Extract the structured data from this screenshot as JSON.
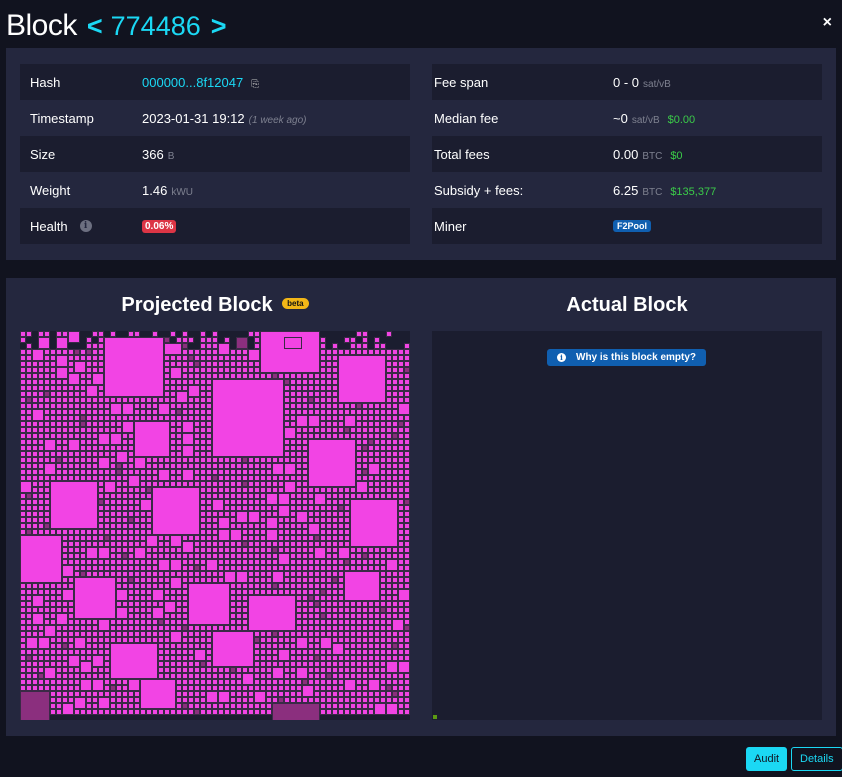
{
  "header": {
    "title": "Block",
    "prev_icon": "chevron-left-icon",
    "prev_glyph": "<",
    "height": "774486",
    "next_glyph": ">",
    "close_glyph": "×"
  },
  "details": {
    "left": [
      {
        "label": "Hash",
        "value": "000000...8f12047",
        "copy_glyph": "⎘"
      },
      {
        "label": "Timestamp",
        "value": "2023-01-31 19:12",
        "ago": "(1 week ago)"
      },
      {
        "label": "Size",
        "value": "366",
        "unit": "B"
      },
      {
        "label": "Weight",
        "value": "1.46",
        "unit": "kWU"
      },
      {
        "label": "Health",
        "info_glyph": "i",
        "value": "0.06%"
      }
    ],
    "right": [
      {
        "label": "Fee span",
        "value": "0 - 0",
        "unit": "sat/vB"
      },
      {
        "label": "Median fee",
        "value": "~0",
        "unit": "sat/vB",
        "fiat": "$0.00"
      },
      {
        "label": "Total fees",
        "value": "0.00",
        "unit": "BTC",
        "fiat": "$0"
      },
      {
        "label": "Subsidy + fees:",
        "value": "6.25",
        "unit": "BTC",
        "fiat": "$135,377"
      },
      {
        "label": "Miner",
        "value": "F2Pool"
      }
    ]
  },
  "visual": {
    "projected_title": "Projected Block",
    "beta_label": "beta",
    "actual_title": "Actual Block",
    "empty_button": "Why is this block empty?",
    "empty_icon_glyph": "i"
  },
  "colors": {
    "accent": "#1bd8f4",
    "tx": "#f244e4",
    "tx_dim": "#8b2f7e",
    "health_badge": "#dc3545",
    "miner_badge": "#105fb0",
    "fiat": "#3bcc49"
  },
  "footer": {
    "audit_label": "Audit",
    "details_label": "Details"
  }
}
